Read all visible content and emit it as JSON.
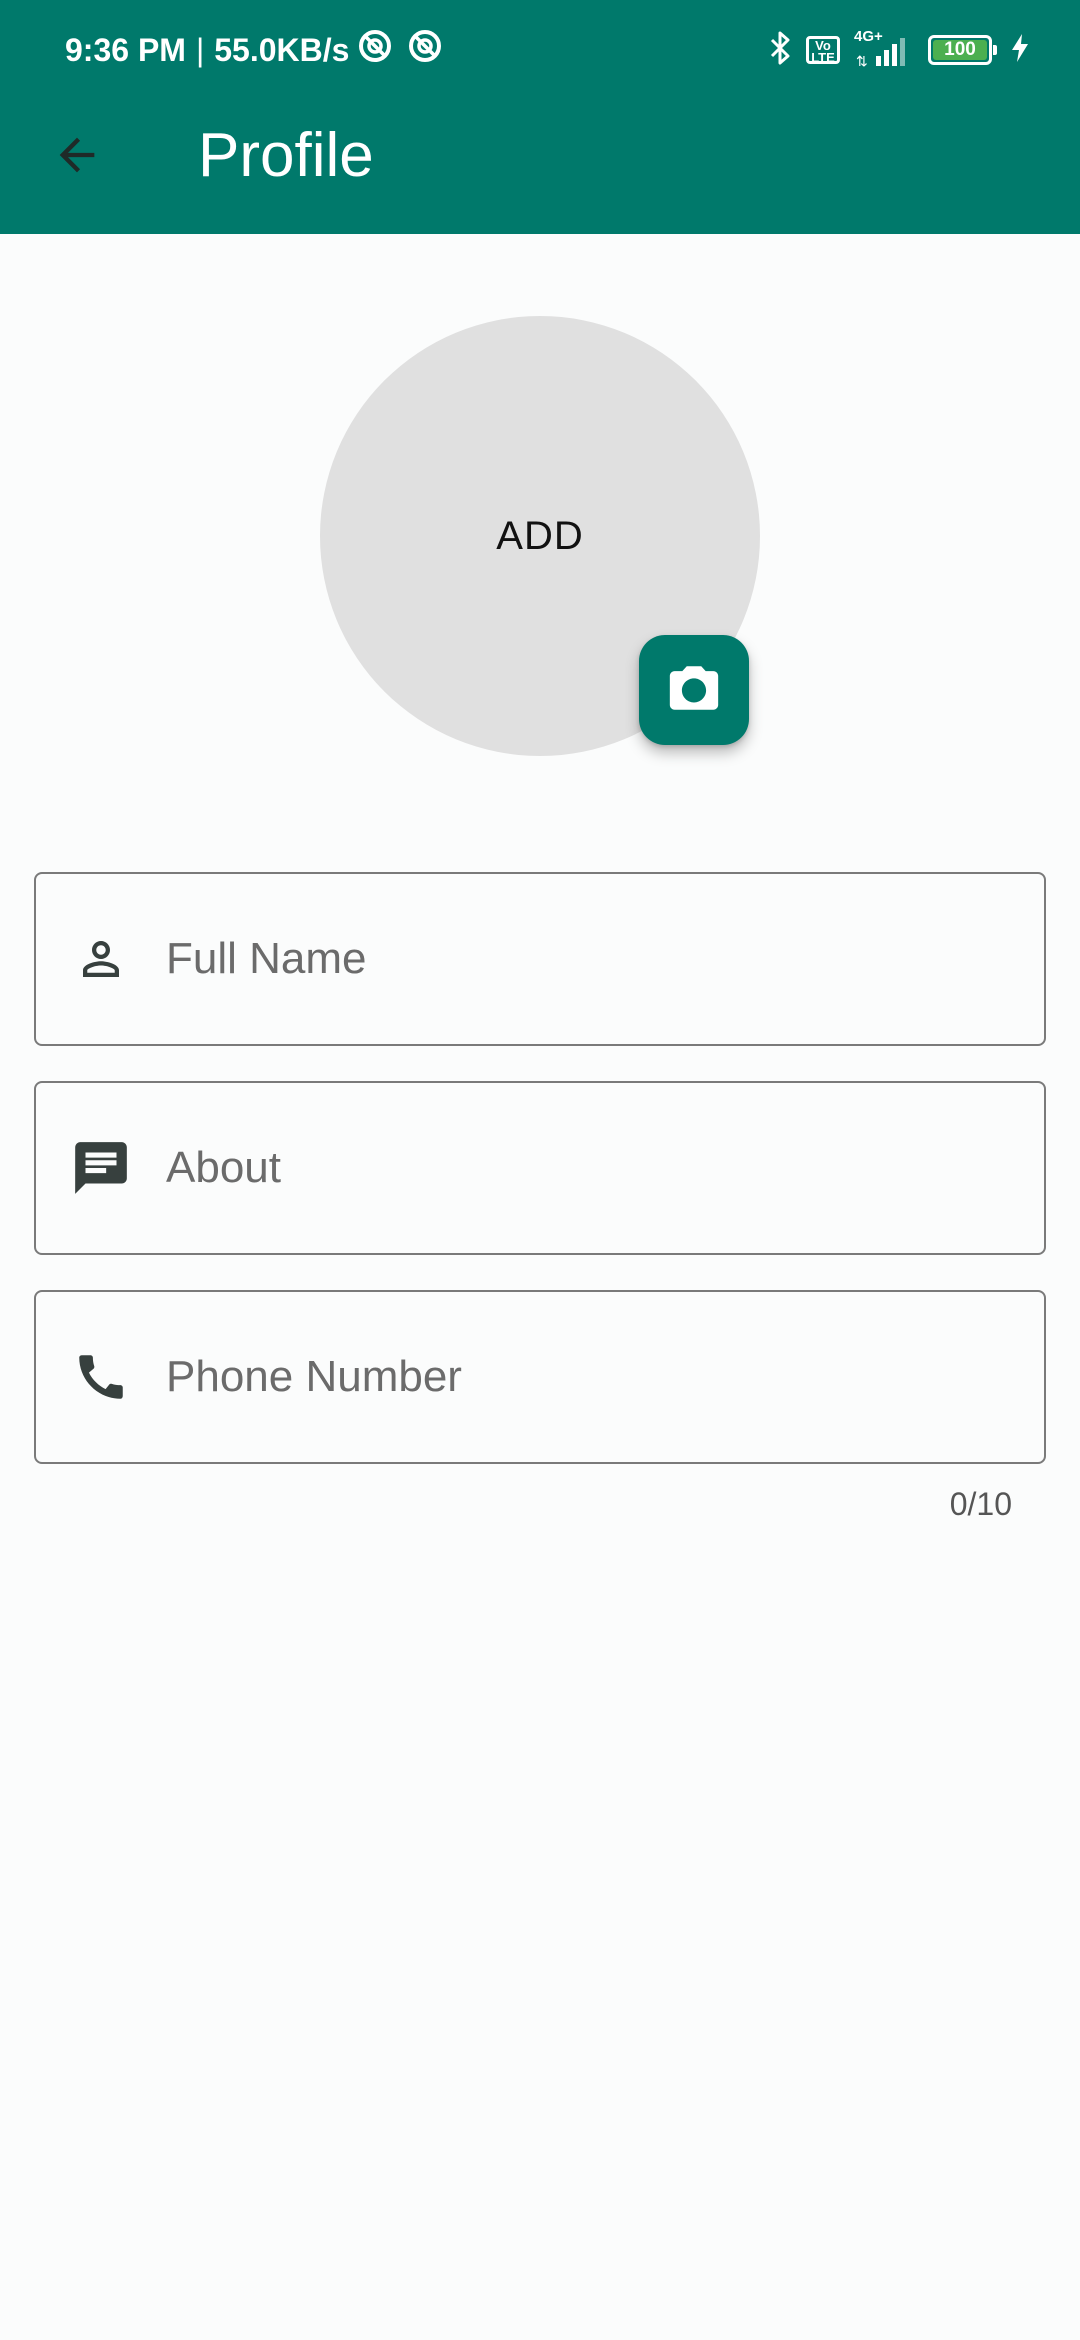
{
  "status_bar": {
    "time": "9:36 PM",
    "separator": "|",
    "network_speed": "55.0KB/s",
    "volte": "Vo LTE",
    "network_type": "4G+",
    "battery_level": "100",
    "icons": [
      "sync-icon",
      "sync-icon",
      "bluetooth-icon",
      "volte-icon",
      "signal-icon",
      "battery-icon",
      "charging-icon"
    ]
  },
  "toolbar": {
    "title": "Profile",
    "back_icon": "arrow-back-icon"
  },
  "avatar": {
    "label": "ADD",
    "camera_icon": "camera-icon"
  },
  "form": {
    "fields": [
      {
        "name": "full-name",
        "placeholder": "Full Name",
        "icon": "person-icon"
      },
      {
        "name": "about",
        "placeholder": "About",
        "icon": "message-icon"
      },
      {
        "name": "phone-number",
        "placeholder": "Phone Number",
        "icon": "phone-icon"
      }
    ],
    "phone_counter": "0/10"
  },
  "colors": {
    "primary": "#00796b",
    "background": "#fbfcfc",
    "avatar_bg": "#e0e0e0",
    "icon": "#37403e"
  }
}
